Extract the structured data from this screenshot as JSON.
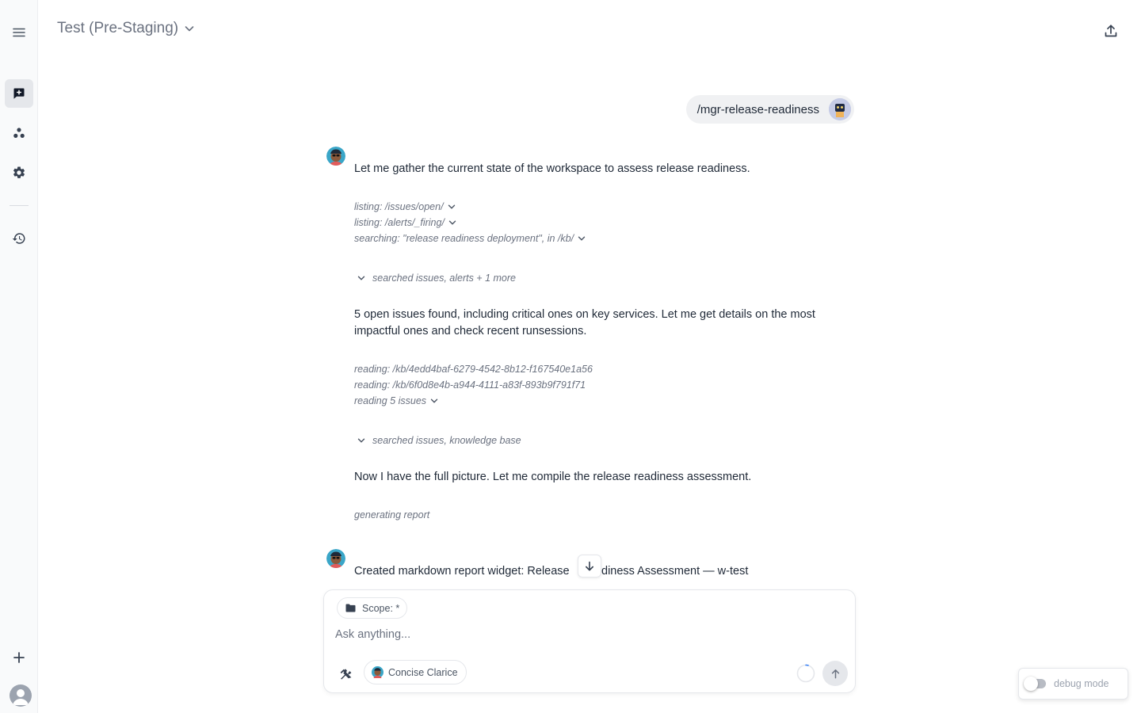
{
  "header": {
    "title": "Test (Pre-Staging)"
  },
  "sidebar": {
    "items": [
      {
        "name": "menu-icon"
      },
      {
        "name": "new-chat-icon"
      },
      {
        "name": "agents-icon"
      },
      {
        "name": "settings-icon"
      },
      {
        "name": "history-icon"
      },
      {
        "name": "add-icon"
      },
      {
        "name": "user-avatar-icon"
      }
    ]
  },
  "chat": {
    "user_message": "/mgr-release-readiness",
    "intro": "Let me gather the current state of the workspace to assess release readiness.",
    "tools_1": [
      "listing: /issues/open/",
      "listing: /alerts/_firing/",
      "searching: \"release readiness deployment\", in /kb/"
    ],
    "collapsed_1": "searched issues, alerts + 1 more",
    "message_2": "5 open issues found, including critical ones on key services. Let me get details on the most impactful ones and check recent runsessions.",
    "tools_2": [
      "reading: /kb/4edd4baf-6279-4542-8b12-f167540e1a56",
      "reading: /kb/6f0d8e4b-a944-4111-a83f-893b9f791f71",
      "reading 5 issues"
    ],
    "collapsed_2": "searched issues, knowledge base",
    "message_3": "Now I have the full picture. Let me compile the release readiness assessment.",
    "status": "generating report",
    "message_4_pre": "Created markdown report widget: Release",
    "message_4_post": "diness Assessment — w-test"
  },
  "composer": {
    "scope_label": "Scope: *",
    "placeholder": "Ask anything...",
    "persona": "Concise Clarice"
  },
  "debug": {
    "label": "debug mode",
    "enabled": false
  }
}
